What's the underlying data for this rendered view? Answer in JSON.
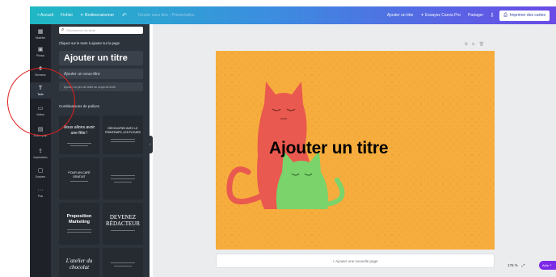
{
  "topbar": {
    "home": "< Accueil",
    "file": "Fichier",
    "resize": "✦ Redimensionner",
    "undo_icon": "↶",
    "title": "Dessin sans titre - Présentation",
    "add_effects": "Ajouter un titre",
    "try_pro": "✦ Essayez Canva Pro",
    "share": "Partager",
    "share_icon": "⇩",
    "download": "Imprimer des cartes",
    "download_icon": "⎙"
  },
  "rail": [
    {
      "icon": "▦",
      "label": "Modèles",
      "name": "templates"
    },
    {
      "icon": "▣",
      "label": "Photos",
      "name": "photos"
    },
    {
      "icon": "❖",
      "label": "Éléments",
      "name": "elements"
    },
    {
      "icon": "T",
      "label": "Texte",
      "name": "text"
    },
    {
      "icon": "▭",
      "label": "Vidéos",
      "name": "videos"
    },
    {
      "icon": "▤",
      "label": "Arrière-plan",
      "name": "background"
    },
    {
      "icon": "⇪",
      "label": "Importations",
      "name": "uploads"
    },
    {
      "icon": "▢",
      "label": "Dossiers",
      "name": "folders"
    },
    {
      "icon": "···",
      "label": "Plus",
      "name": "more"
    }
  ],
  "panel": {
    "search_icon": "⌕",
    "search_placeholder": "Rechercher du texte",
    "hint": "Cliquez sur le texte à ajouter sur la page",
    "add_title": "Ajouter un titre",
    "add_subtitle": "Ajouter un sous-titre",
    "add_body": "Ajouter un peu de texte au corps de texte",
    "combos_title": "Combinaisons de polices",
    "cards": [
      {
        "l1": "Nous allons avoir",
        "l2": "une fête !"
      },
      {
        "l1": "DÉCOUVREZ AVEC LE",
        "l2": "PRINTEMPS, LES FLEURS"
      },
      {
        "l1": "POUR UN CAFÉ",
        "l2": "GRATUIT"
      },
      {
        "l1": "",
        "l2": ""
      },
      {
        "l1": "Proposition",
        "l2": "Marketing"
      },
      {
        "l1": "DEVENEZ",
        "l2": "RÉDACTEUR"
      },
      {
        "l1": "L'atelier du",
        "l2": "chocolat"
      },
      {
        "l1": "",
        "l2": ""
      }
    ],
    "collapse": "‹"
  },
  "canvas": {
    "page_tools": [
      "⧉",
      "⊕",
      "🗑"
    ],
    "title": "Ajouter un titre",
    "add_page": "+ Ajouter une nouvelle page",
    "zoom": "176 %",
    "fullscreen": "⤢",
    "help": "Aide ?"
  },
  "colors": {
    "page_bg": "#f6ad3d",
    "cat_red": "#e9594f",
    "cat_green": "#7ad36b",
    "accent": "#7d2ae8"
  }
}
